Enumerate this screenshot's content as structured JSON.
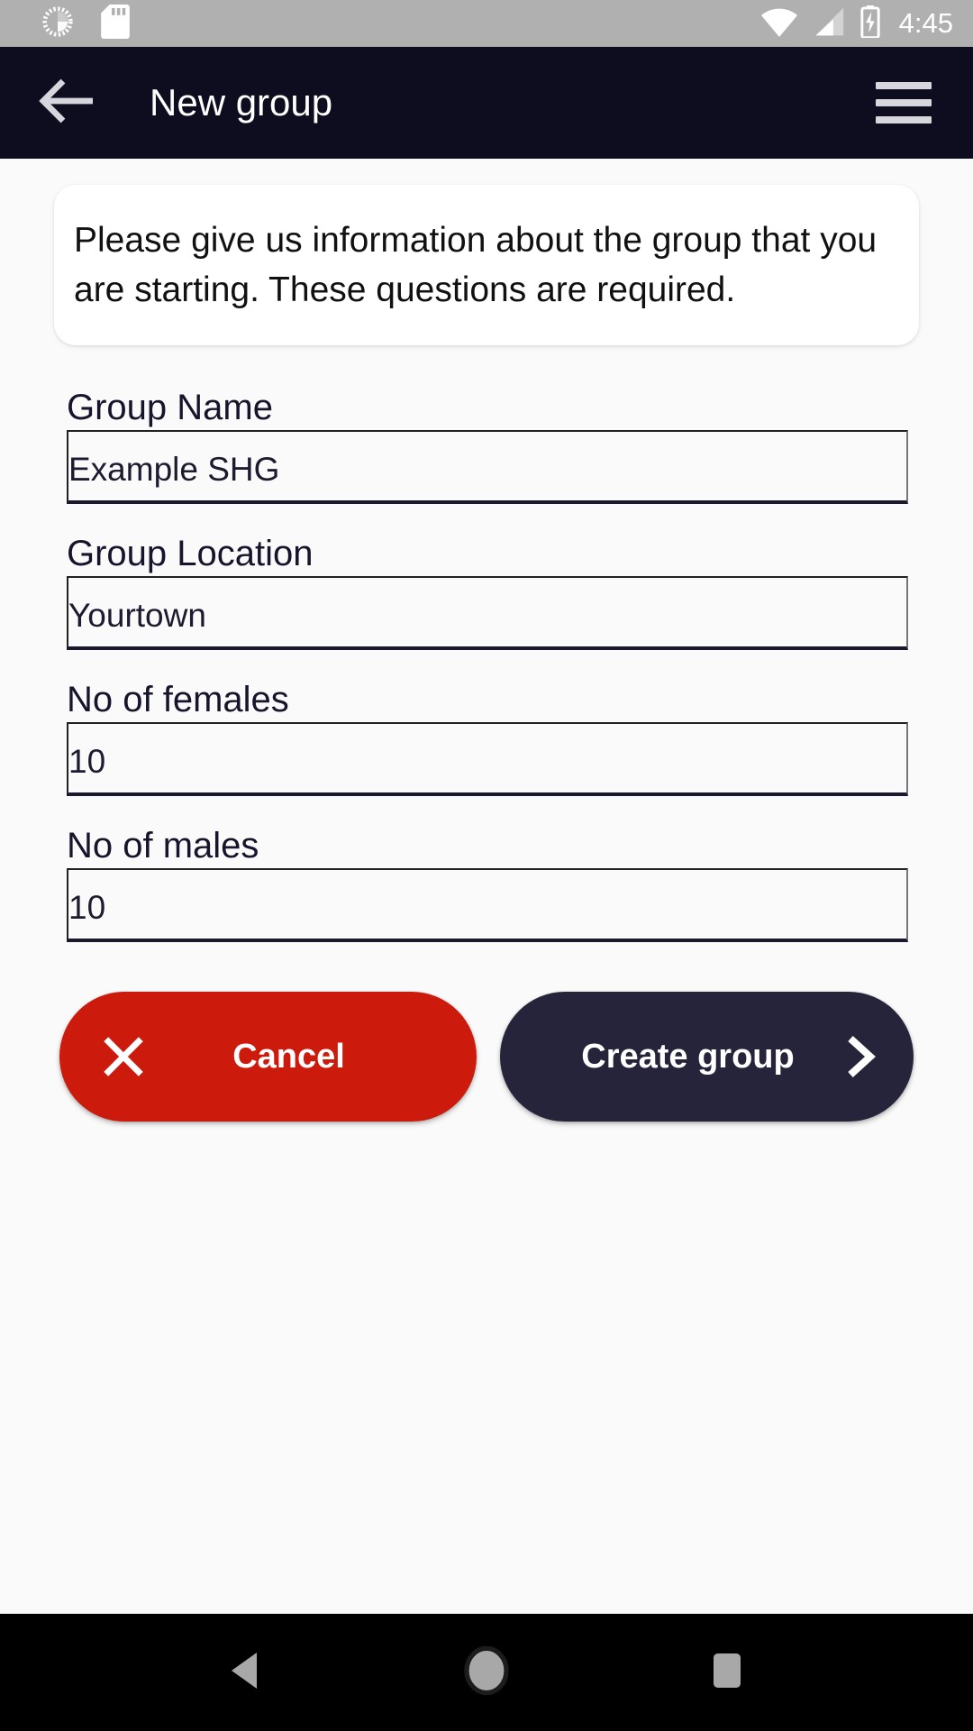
{
  "status_bar": {
    "time": "4:45",
    "left_icons": [
      "sync-spinner-icon",
      "sd-card-icon"
    ],
    "right_icons": [
      "wifi-icon",
      "cell-signal-icon",
      "battery-charging-icon"
    ],
    "background_color": "#b0b0b0",
    "foreground_color": "#ffffff"
  },
  "app_bar": {
    "title": "New group",
    "back_icon": "arrow-left-icon",
    "menu_icon": "hamburger-menu-icon",
    "background_color": "#0e0d1f"
  },
  "info_card": {
    "text": "Please give us information about the group that you are starting. These questions are required."
  },
  "form": {
    "fields": [
      {
        "label": "Group Name",
        "value": "Example SHG",
        "placeholder": "Group Name",
        "name": "group-name"
      },
      {
        "label": "Group Location",
        "value": "Yourtown",
        "placeholder": "Group Location",
        "name": "group-location"
      },
      {
        "label": "No of females",
        "value": "10",
        "placeholder": "No of females",
        "name": "no-of-females"
      },
      {
        "label": "No of males",
        "value": "10",
        "placeholder": "No of males",
        "name": "no-of-males"
      }
    ]
  },
  "actions": {
    "cancel": {
      "label": "Cancel",
      "icon": "close-x-icon",
      "color": "#cc1a0c"
    },
    "create": {
      "label": "Create group",
      "icon": "chevron-right-icon",
      "color": "#25243a"
    }
  },
  "nav_bar": {
    "back": "triangle-back-icon",
    "home": "circle-home-icon",
    "recents": "square-recents-icon",
    "background_color": "#000000"
  }
}
